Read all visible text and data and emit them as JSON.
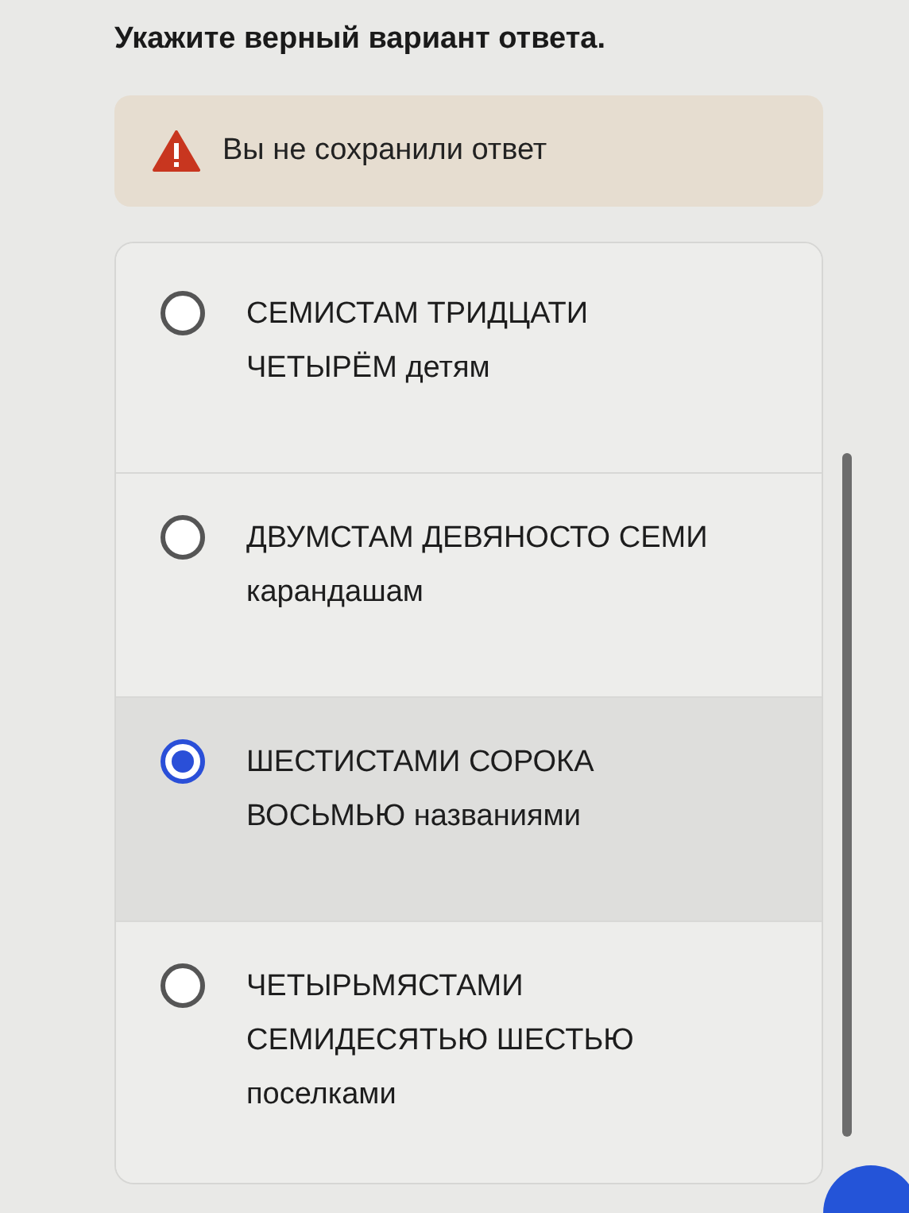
{
  "question": {
    "title": "Укажите верный вариант ответа."
  },
  "warning": {
    "text": "Вы не сохранили ответ"
  },
  "options": [
    {
      "label": "СЕМИСТАМ ТРИДЦАТИ ЧЕТЫРЁМ детям",
      "selected": false
    },
    {
      "label": "ДВУМСТАМ ДЕВЯНОСТО СЕМИ карандашам",
      "selected": false
    },
    {
      "label": "ШЕСТИСТАМИ СОРОКА ВОСЬМЬЮ названиями",
      "selected": true
    },
    {
      "label": "ЧЕТЫРЬМЯСТАМИ СЕМИДЕСЯТЬЮ ШЕСТЬЮ поселками",
      "selected": false
    }
  ]
}
